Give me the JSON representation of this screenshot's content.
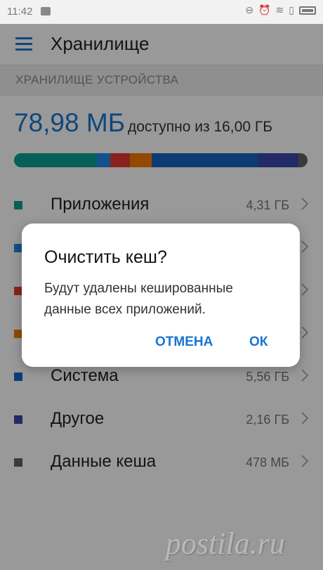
{
  "status_bar": {
    "time": "11:42"
  },
  "app_bar": {
    "title": "Хранилище"
  },
  "section": {
    "header": "ХРАНИЛИЩЕ УСТРОЙСТВА"
  },
  "storage": {
    "available": "78,98 МБ",
    "of_total": "доступно из 16,00 ГБ"
  },
  "storage_bar": [
    {
      "color": "#0a9e95",
      "weight": 4.31
    },
    {
      "color": "#1e88e5",
      "weight": 0.75
    },
    {
      "color": "#e53935",
      "weight": 1.05
    },
    {
      "color": "#f57c00",
      "weight": 1.15
    },
    {
      "color": "#1565c0",
      "weight": 5.56
    },
    {
      "color": "#3949ab",
      "weight": 2.16
    },
    {
      "color": "#616161",
      "weight": 0.478
    }
  ],
  "list": {
    "items": [
      {
        "label": "Приложения",
        "size": "4,31 ГБ",
        "color": "#0a9e95"
      },
      {
        "label": "",
        "size": "",
        "color": "#1e88e5"
      },
      {
        "label": "",
        "size": "",
        "color": "#e53935"
      },
      {
        "label": "",
        "size": "",
        "color": "#f57c00"
      },
      {
        "label": "Система",
        "size": "5,56 ГБ",
        "color": "#1565c0"
      },
      {
        "label": "Другое",
        "size": "2,16 ГБ",
        "color": "#3949ab"
      },
      {
        "label": "Данные кеша",
        "size": "478 МБ",
        "color": "#616161"
      }
    ]
  },
  "dialog": {
    "title": "Очистить кеш?",
    "message": "Будут удалены кешированные данные всех приложений.",
    "cancel_label": "ОТМЕНА",
    "ok_label": "ОК"
  },
  "watermark": {
    "text": "postila.ru"
  },
  "colors": {
    "accent": "#1976d2",
    "scrim": "rgba(0,0,0,0.40)"
  }
}
